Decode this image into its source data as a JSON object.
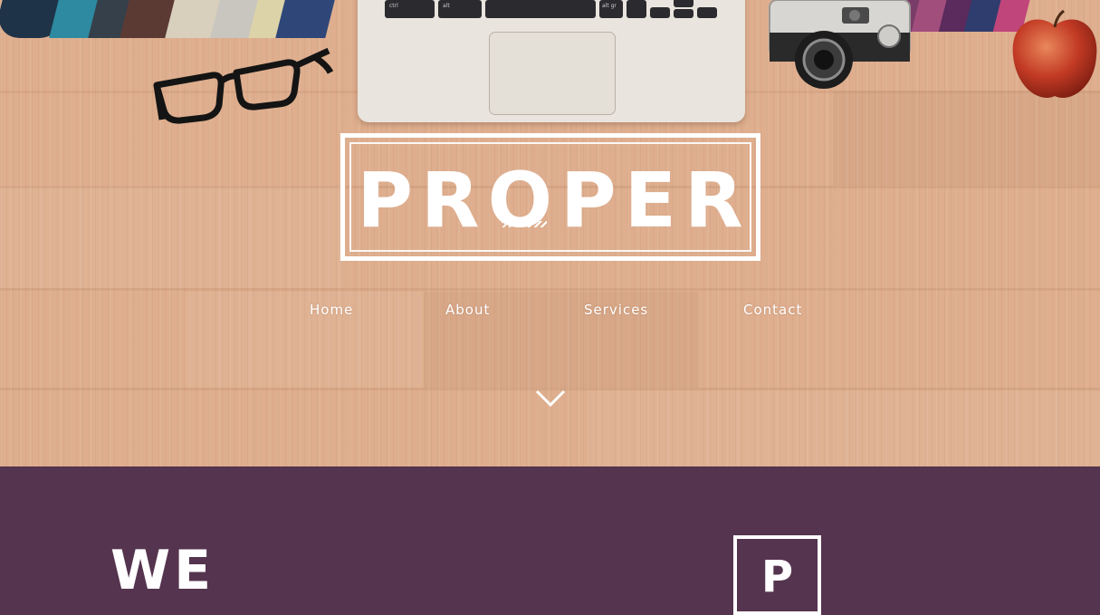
{
  "logo": {
    "text": "PROPER"
  },
  "nav": {
    "items": [
      {
        "label": "Home"
      },
      {
        "label": "About"
      },
      {
        "label": "Services"
      },
      {
        "label": "Contact"
      }
    ]
  },
  "keyboard": {
    "key_ctrl": "ctrl",
    "key_alt": "alt",
    "key_altgr": "alt gr"
  },
  "intro": {
    "heading": "WE",
    "badge_letter": "P"
  },
  "colors": {
    "hero_wood": "#deae8e",
    "section_bg": "#55344f",
    "foreground": "#ffffff"
  }
}
